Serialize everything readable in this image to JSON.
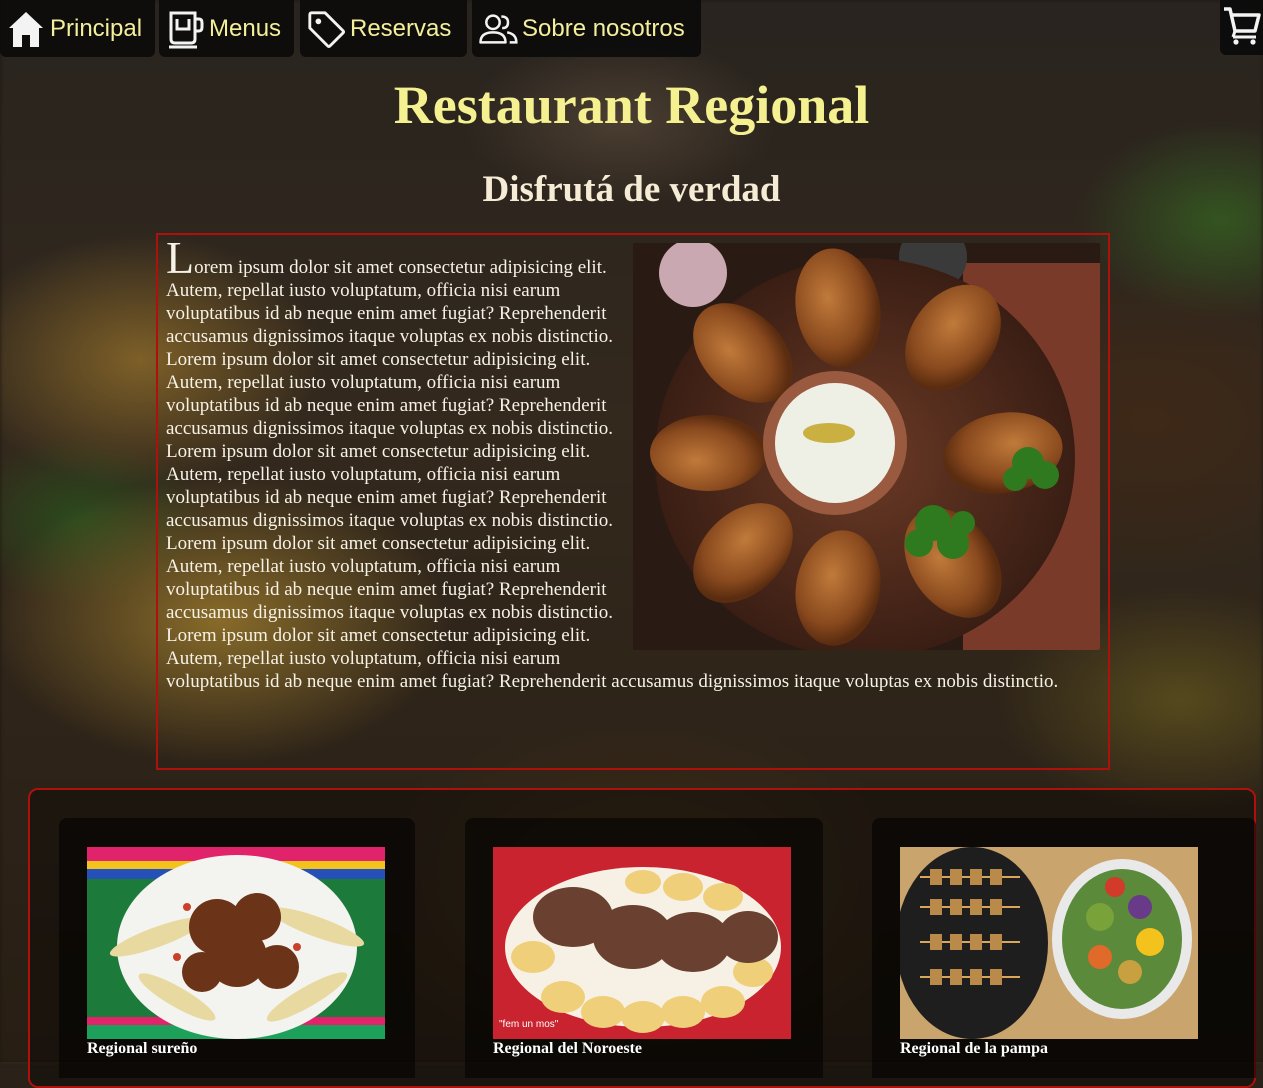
{
  "nav": {
    "items": [
      {
        "label": "Principal",
        "icon": "home-icon"
      },
      {
        "label": "Menus",
        "icon": "coffee-cup-icon"
      },
      {
        "label": "Reservas",
        "icon": "tag-icon"
      },
      {
        "label": "Sobre nosotros",
        "icon": "users-icon"
      }
    ],
    "cart_icon": "cart-icon"
  },
  "header": {
    "title": "Restaurant Regional",
    "subtitle": "Disfrutá de verdad"
  },
  "article": {
    "text": "Lorem ipsum dolor sit amet consectetur adipisicing elit. Autem, repellat iusto voluptatum, officia nisi earum voluptatibus id ab neque enim amet fugiat? Reprehenderit accusamus dignissimos itaque voluptas ex nobis distinctio. Lorem ipsum dolor sit amet consectetur adipisicing elit. Autem, repellat iusto voluptatum, officia nisi earum voluptatibus id ab neque enim amet fugiat? Reprehenderit accusamus dignissimos itaque voluptas ex nobis distinctio. Lorem ipsum dolor sit amet consectetur adipisicing elit. Autem, repellat iusto voluptatum, officia nisi earum voluptatibus id ab neque enim amet fugiat? Reprehenderit accusamus dignissimos itaque voluptas ex nobis distinctio. Lorem ipsum dolor sit amet consectetur adipisicing elit. Autem, repellat iusto voluptatum, officia nisi earum voluptatibus id ab neque enim amet fugiat? Reprehenderit accusamus dignissimos itaque voluptas ex nobis distinctio. Lorem ipsum dolor sit amet consectetur adipisicing elit. Autem, repellat iusto voluptatum, officia nisi earum voluptatibus id ab neque enim amet fugiat? Reprehenderit accusamus dignissimos itaque voluptas ex nobis distinctio."
  },
  "cards": [
    {
      "caption": "Regional sureño"
    },
    {
      "caption": "Regional del Noroeste",
      "watermark": "\"fem un mos\""
    },
    {
      "caption": "Regional de la pampa"
    }
  ],
  "colors": {
    "accent": "#f5f190",
    "border": "#b0100c",
    "nav_bg": "#0a0a0a"
  }
}
